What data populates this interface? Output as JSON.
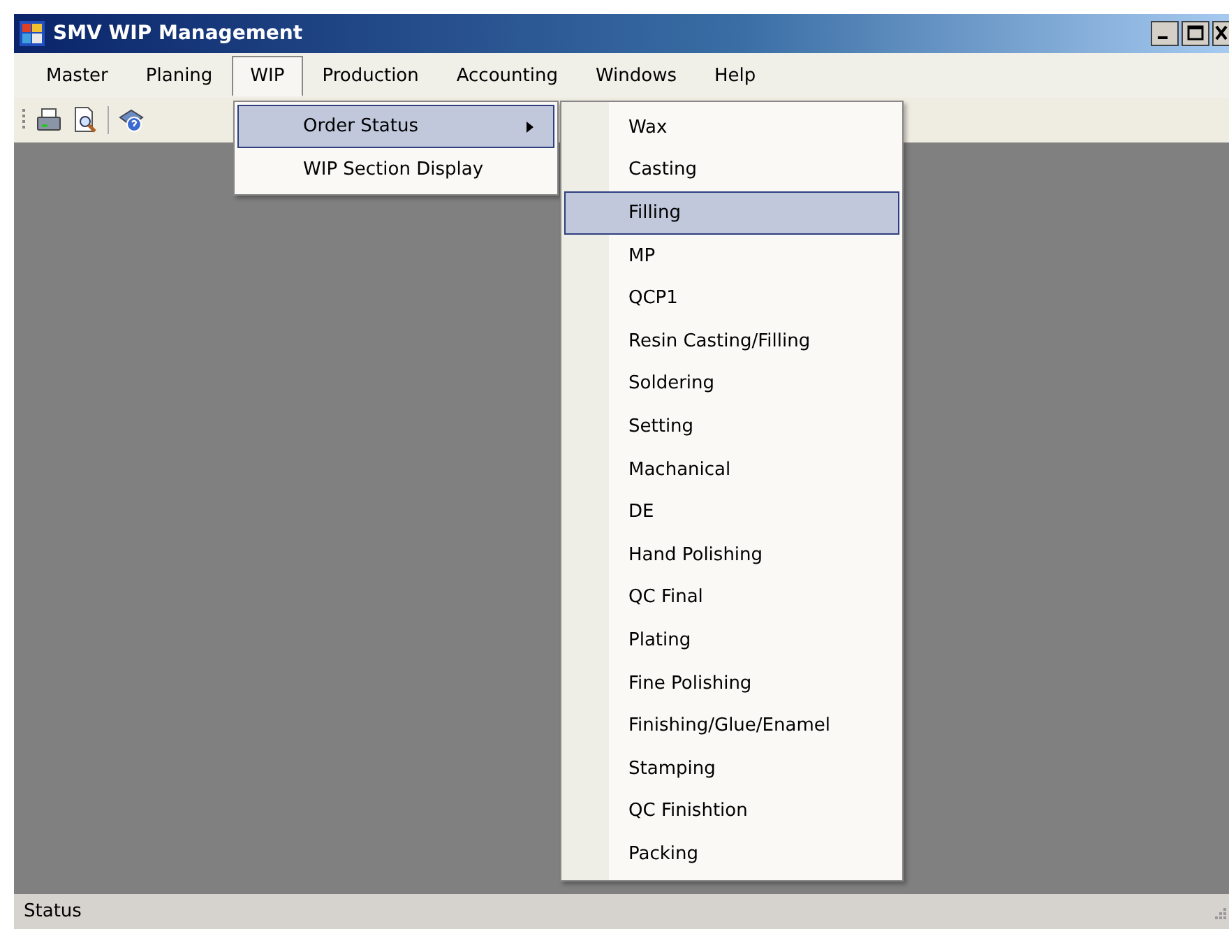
{
  "window": {
    "title": "SMV WIP Management"
  },
  "menu": [
    {
      "label": "Master",
      "selected": false
    },
    {
      "label": "Planing",
      "selected": false
    },
    {
      "label": "WIP",
      "selected": true
    },
    {
      "label": "Production",
      "selected": false
    },
    {
      "label": "Accounting",
      "selected": false
    },
    {
      "label": "Windows",
      "selected": false
    },
    {
      "label": "Help",
      "selected": false
    }
  ],
  "dropdown": [
    {
      "label": "Order Status",
      "selected": true,
      "has_submenu": true
    },
    {
      "label": "WIP Section Display",
      "selected": false,
      "has_submenu": false
    }
  ],
  "submenu": [
    {
      "label": "Wax",
      "selected": false
    },
    {
      "label": "Casting",
      "selected": false
    },
    {
      "label": "Filling",
      "selected": true
    },
    {
      "label": "MP",
      "selected": false
    },
    {
      "label": "QCP1",
      "selected": false
    },
    {
      "label": "Resin Casting/Filling",
      "selected": false
    },
    {
      "label": "Soldering",
      "selected": false
    },
    {
      "label": "Setting",
      "selected": false
    },
    {
      "label": "Machanical",
      "selected": false
    },
    {
      "label": "DE",
      "selected": false
    },
    {
      "label": "Hand Polishing",
      "selected": false
    },
    {
      "label": "QC Final",
      "selected": false
    },
    {
      "label": "Plating",
      "selected": false
    },
    {
      "label": "Fine Polishing",
      "selected": false
    },
    {
      "label": "Finishing/Glue/Enamel",
      "selected": false
    },
    {
      "label": "Stamping",
      "selected": false
    },
    {
      "label": "QC Finishtion",
      "selected": false
    },
    {
      "label": "Packing",
      "selected": false
    }
  ],
  "status_bar": {
    "text": "Status"
  }
}
